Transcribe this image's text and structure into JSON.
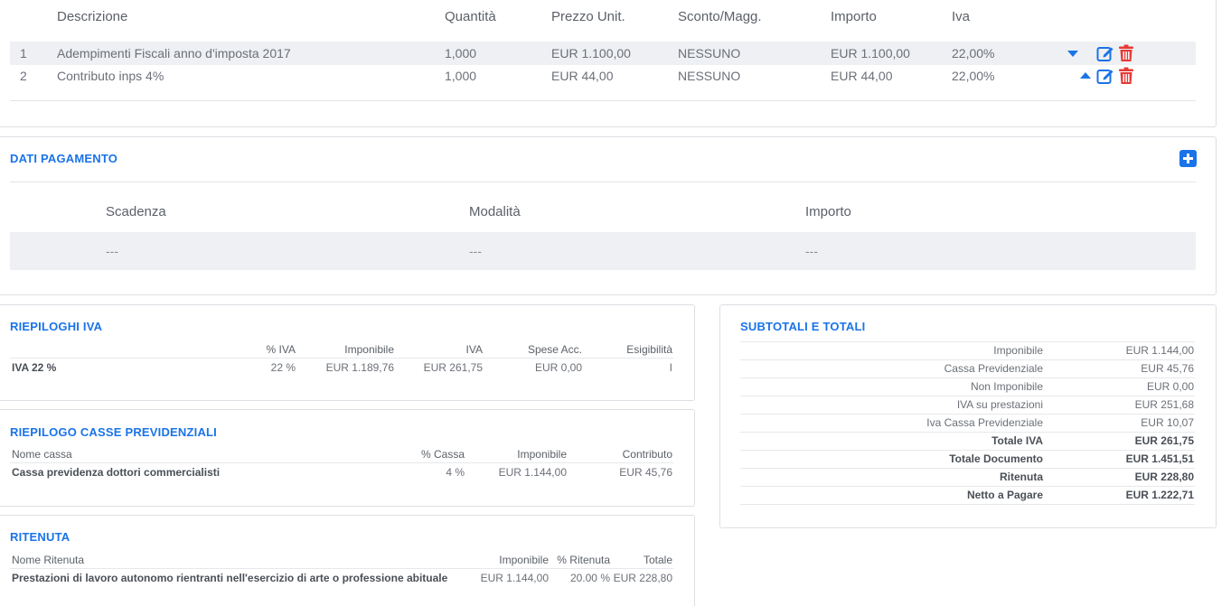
{
  "lines": {
    "headers": {
      "description": "Descrizione",
      "quantity": "Quantità",
      "unit_price": "Prezzo Unit.",
      "discount": "Sconto/Magg.",
      "amount": "Importo",
      "vat": "Iva"
    },
    "rows": [
      {
        "num": "1",
        "description": "Adempimenti Fiscali anno d'imposta 2017",
        "quantity": "1,000",
        "unit_price": "EUR 1.100,00",
        "discount": "NESSUNO",
        "amount": "EUR 1.100,00",
        "vat": "22,00%"
      },
      {
        "num": "2",
        "description": "Contributo inps 4%",
        "quantity": "1,000",
        "unit_price": "EUR 44,00",
        "discount": "NESSUNO",
        "amount": "EUR 44,00",
        "vat": "22,00%"
      }
    ],
    "icons": {
      "move_down": "caret-down-icon",
      "move_up": "caret-up-icon",
      "edit": "edit-icon",
      "delete": "trash-icon"
    },
    "colors": {
      "accent": "#1a73e8",
      "danger": "#e53935",
      "row_shade": "#eef0f3"
    }
  },
  "payment": {
    "title": "DATI PAGAMENTO",
    "add_icon": "plus-square-icon",
    "headers": {
      "due_date": "Scadenza",
      "method": "Modalità",
      "amount": "Importo"
    },
    "row": {
      "due_date": "---",
      "method": "---",
      "amount": "---"
    }
  },
  "vat_summary": {
    "title": "RIEPILOGHI IVA",
    "headers": {
      "percent": "% IVA",
      "taxable": "Imponibile",
      "vat": "IVA",
      "expenses": "Spese Acc.",
      "eligibility": "Esigibilità"
    },
    "row": {
      "label": "IVA 22 %",
      "percent": "22 %",
      "taxable": "EUR 1.189,76",
      "vat": "EUR 261,75",
      "expenses": "EUR 0,00",
      "eligibility": "I"
    }
  },
  "pension_funds": {
    "title": "RIEPILOGO CASSE PREVIDENZIALI",
    "headers": {
      "name": "Nome cassa",
      "percent": "% Cassa",
      "taxable": "Imponibile",
      "contribution": "Contributo"
    },
    "row": {
      "name": "Cassa previdenza dottori commercialisti",
      "percent": "4 %",
      "taxable": "EUR 1.144,00",
      "contribution": "EUR 45,76"
    }
  },
  "withholding": {
    "title": "RITENUTA",
    "headers": {
      "name": "Nome Ritenuta",
      "taxable": "Imponibile",
      "percent": "% Ritenuta",
      "total": "Totale"
    },
    "row": {
      "name": "Prestazioni di lavoro autonomo rientranti nell'esercizio di arte o professione abituale",
      "taxable": "EUR 1.144,00",
      "percent": "20.00 %",
      "total": "EUR 228,80"
    }
  },
  "totals": {
    "title": "SUBTOTALI E TOTALI",
    "rows": [
      {
        "label": "Imponibile",
        "value": "EUR 1.144,00"
      },
      {
        "label": "Cassa Previdenziale",
        "value": "EUR 45,76"
      },
      {
        "label": "Non Imponibile",
        "value": "EUR 0,00"
      },
      {
        "label": "IVA su prestazioni",
        "value": "EUR 251,68"
      },
      {
        "label": "Iva Cassa Previdenziale",
        "value": "EUR 10,07"
      },
      {
        "label": "Totale IVA",
        "value": "EUR 261,75"
      },
      {
        "label": "Totale Documento",
        "value": "EUR 1.451,51"
      },
      {
        "label": "Ritenuta",
        "value": "EUR 228,80"
      },
      {
        "label": "Netto a Pagare",
        "value": "EUR 1.222,71"
      }
    ]
  }
}
